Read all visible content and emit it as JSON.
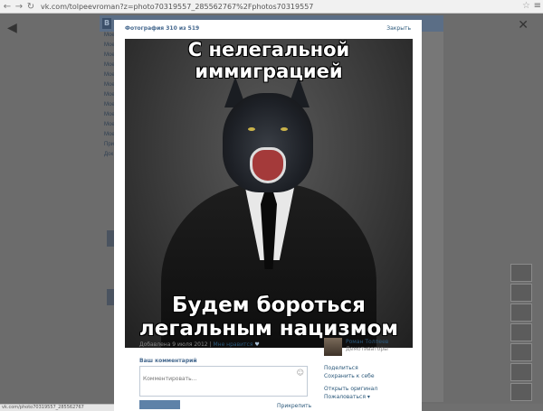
{
  "browser": {
    "url": "vk.com/tolpeevroman?z=photo70319557_285562767%2Fphotos70319557",
    "back_icon": "arrow-left-icon",
    "forward_icon": "arrow-right-icon",
    "reload_icon": "reload-icon",
    "star_icon": "star-icon",
    "menu_icon": "menu-icon"
  },
  "modal": {
    "counter": "Фотография 310 из 519",
    "close_label": "Закрыть",
    "photo": {
      "caption_top": "С нелегальной иммиграцией",
      "caption_bottom": "Будем бороться легальным нацизмом"
    },
    "info": {
      "date": "Добавлена 9 июля 2012",
      "separator": "|",
      "like_label": "Мне нравится"
    },
    "comment": {
      "label": "Ваш комментарий",
      "placeholder": "Комментировать...",
      "attach_label": "Прикрепить"
    },
    "author": {
      "name": "Роман Толпеев",
      "album": "Демотиваторы"
    },
    "actions": {
      "share": "Поделиться",
      "save": "Сохранить к себе",
      "original": "Открыть оригинал",
      "report": "Пожаловаться"
    }
  },
  "background_page": {
    "sidebar_items": [
      "Мое",
      "Мое",
      "Мое",
      "Мое",
      "Мое",
      "Мое",
      "Мое",
      "Мое",
      "Мое",
      "Мое",
      "Мое",
      "Прил",
      "Док"
    ]
  },
  "statusbar": {
    "text": "vk.com/photo70319557_285562767"
  },
  "colors": {
    "accent": "#45688e",
    "link": "#2b587a",
    "overlay": "#6f6f6f"
  }
}
